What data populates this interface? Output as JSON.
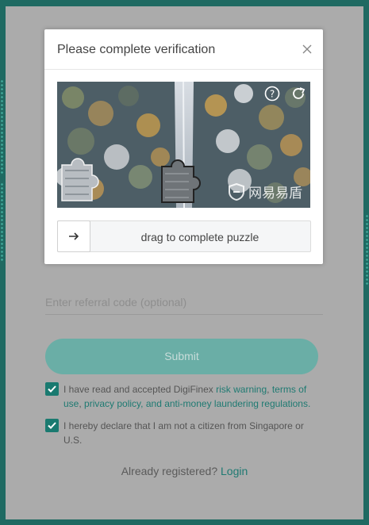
{
  "modal": {
    "title": "Please complete verification",
    "slider_text": "drag to complete puzzle",
    "watermark": "网易易盾"
  },
  "form": {
    "referral_placeholder": "Enter referral code (optional)",
    "submit_label": "Submit",
    "terms": {
      "checked": true,
      "prefix": "I have read and accepted DigiFinex ",
      "risk_link": "risk warning",
      "sep1": ", ",
      "terms_link": "terms of use",
      "sep2": ", ",
      "privacy_link": "privacy policy",
      "sep3": ", and ",
      "aml_link": "anti-money laundering regulations",
      "suffix": "."
    },
    "citizen": {
      "checked": true,
      "text": "I hereby declare that I am not a citizen from Singapore or U.S."
    },
    "already_text": "Already registered? ",
    "login_link": "Login"
  },
  "colors": {
    "frame": "#1f6a62",
    "accent": "#1f7a72",
    "submit_bg": "#6aaea6",
    "overlay": "#ababab"
  }
}
